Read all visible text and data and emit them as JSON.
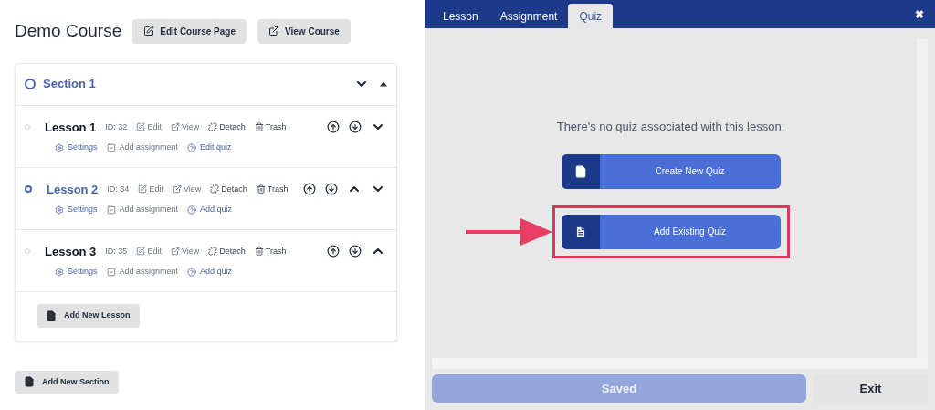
{
  "course": {
    "title": "Demo Course",
    "buttons": [
      {
        "kind": "edit",
        "label": "Edit Course Page"
      },
      {
        "kind": "external",
        "label": "View Course"
      }
    ]
  },
  "section": {
    "title": "Section 1",
    "lessons": [
      {
        "title": "Lesson 1",
        "id": "ID: 32",
        "selected": false,
        "actions": [
          {
            "kind": "edit",
            "label": "Edit"
          },
          {
            "kind": "external",
            "label": "View"
          },
          {
            "kind": "detach",
            "label": "Detach"
          },
          {
            "kind": "trash",
            "label": "Trash"
          }
        ],
        "links": [
          {
            "kind": "settings",
            "label": "Settings"
          },
          {
            "kind": "check",
            "label": "Add assignment"
          },
          {
            "kind": "help",
            "label": "Edit quiz"
          }
        ],
        "controls": [
          {
            "kind": "up"
          },
          {
            "kind": "down"
          },
          {
            "kind": "expand"
          }
        ]
      },
      {
        "title": "Lesson 2",
        "id": "ID: 34",
        "selected": true,
        "actions": [
          {
            "kind": "edit",
            "label": "Edit"
          },
          {
            "kind": "external",
            "label": "View"
          },
          {
            "kind": "detach",
            "label": "Detach"
          },
          {
            "kind": "trash",
            "label": "Trash"
          }
        ],
        "links": [
          {
            "kind": "settings",
            "label": "Settings"
          },
          {
            "kind": "check",
            "label": "Add assignment"
          },
          {
            "kind": "help",
            "label": "Add quiz"
          }
        ],
        "controls": [
          {
            "kind": "up"
          },
          {
            "kind": "down"
          },
          {
            "kind": "collapse"
          },
          {
            "kind": "expand"
          }
        ]
      },
      {
        "title": "Lesson 3",
        "id": "ID: 35",
        "selected": false,
        "actions": [
          {
            "kind": "edit",
            "label": "Edit"
          },
          {
            "kind": "external",
            "label": "View"
          },
          {
            "kind": "detach",
            "label": "Detach"
          },
          {
            "kind": "trash",
            "label": "Trash"
          }
        ],
        "links": [
          {
            "kind": "settings",
            "label": "Settings"
          },
          {
            "kind": "check",
            "label": "Add assignment"
          },
          {
            "kind": "help",
            "label": "Add quiz"
          }
        ],
        "controls": [
          {
            "kind": "up"
          },
          {
            "kind": "down"
          },
          {
            "kind": "collapse"
          }
        ]
      }
    ],
    "add_lesson": "Add New Lesson"
  },
  "add_section": "Add New Section",
  "dialog": {
    "tabs": [
      {
        "label": "Lesson",
        "selected": false
      },
      {
        "label": "Assignment",
        "selected": false
      },
      {
        "label": "Quiz",
        "selected": true
      }
    ],
    "close": "✖",
    "message": "There's no quiz associated with this lesson.",
    "options": [
      {
        "kind": "new",
        "label": "Create New Quiz",
        "highlighted": false
      },
      {
        "kind": "existing",
        "label": "Add Existing Quiz",
        "highlighted": true
      }
    ],
    "save": {
      "label": "Saved",
      "disabled": true
    },
    "exit": "Exit"
  }
}
